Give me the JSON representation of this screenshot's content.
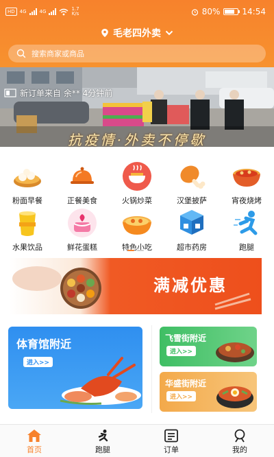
{
  "status_bar": {
    "hd_badge": "HD",
    "net_1": "4G",
    "net_2": "4G",
    "speed_value": "1.7",
    "speed_unit": "K/s",
    "battery_percent": "80%",
    "battery_level": 0.8,
    "time": "14:54"
  },
  "header": {
    "location": "毛老四外卖",
    "search_placeholder": "搜索商家或商品"
  },
  "banner": {
    "ticker": "新订单来自 余** 4分钟前",
    "caption": "抗疫情·外卖不停歇"
  },
  "categories": [
    {
      "label": "粉面早餐",
      "icon": "dumpling-icon"
    },
    {
      "label": "正餐美食",
      "icon": "cloche-icon"
    },
    {
      "label": "火锅炒菜",
      "icon": "hotpot-icon"
    },
    {
      "label": "汉堡披萨",
      "icon": "chicken-leg-icon"
    },
    {
      "label": "宵夜烧烤",
      "icon": "bbq-bowl-icon"
    },
    {
      "label": "水果饮品",
      "icon": "juice-cup-icon"
    },
    {
      "label": "鲜花蛋糕",
      "icon": "cake-icon"
    },
    {
      "label": "特色小吃",
      "icon": "snack-bowl-icon"
    },
    {
      "label": "超市药房",
      "icon": "boxes-icon"
    },
    {
      "label": "跑腿",
      "icon": "runner-icon"
    }
  ],
  "promo": {
    "title": "满减优惠"
  },
  "cards": {
    "main": {
      "title": "体育馆附近",
      "button": "进入>>"
    },
    "side1": {
      "title": "飞雪街附近",
      "button": "进入>>"
    },
    "side2": {
      "title": "华盛街附近",
      "button": "进入>>"
    }
  },
  "nav": {
    "items": [
      {
        "label": "首页",
        "icon": "home-icon"
      },
      {
        "label": "跑腿",
        "icon": "runner-icon"
      },
      {
        "label": "订单",
        "icon": "order-list-icon"
      },
      {
        "label": "我的",
        "icon": "profile-icon"
      }
    ]
  },
  "colors": {
    "brand": "#f7822c",
    "promo": "#ee4f1c",
    "card_blue": "#2f8ff0",
    "card_green": "#3fbe64",
    "card_orange": "#f3a94a"
  }
}
